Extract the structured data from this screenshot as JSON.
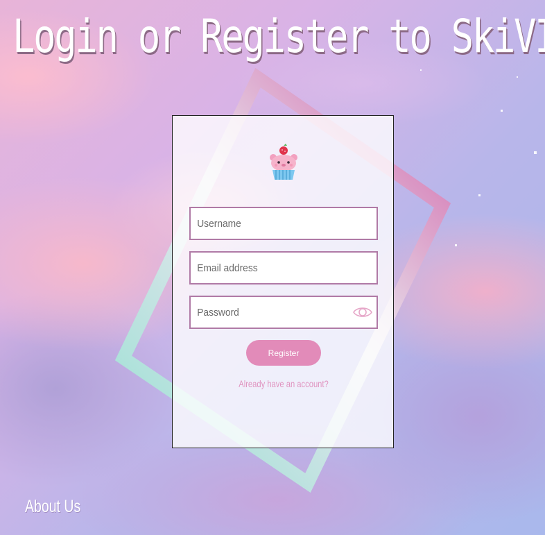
{
  "header": {
    "title": "Login or Register to SkiVI"
  },
  "form": {
    "username_placeholder": "Username",
    "email_placeholder": "Email address",
    "password_placeholder": "Password",
    "password_toggle_icon": "eye-icon",
    "register_label": "Register",
    "login_link": "Already have an account?"
  },
  "logo": {
    "icon": "cupcake-bear-logo"
  },
  "footer": {
    "about_link": "About Us"
  },
  "colors": {
    "accent": "#e28bb9",
    "field_border": "#b07aa6",
    "frame_pink": "#d37bb4",
    "frame_teal": "#a5dfd6",
    "title_text": "#ffffff"
  }
}
